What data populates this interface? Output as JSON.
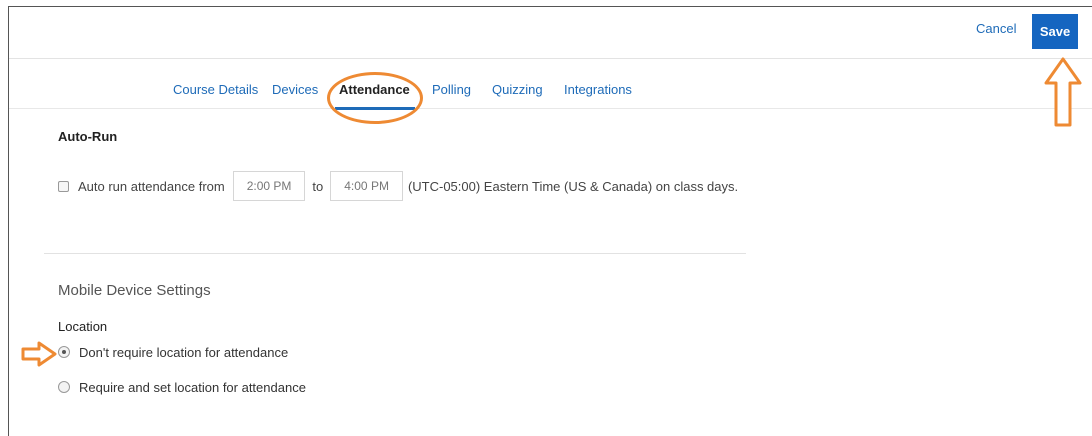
{
  "header": {
    "cancel_label": "Cancel",
    "save_label": "Save"
  },
  "tabs": [
    {
      "label": "Course Details",
      "active": false
    },
    {
      "label": "Devices",
      "active": false
    },
    {
      "label": "Attendance",
      "active": true
    },
    {
      "label": "Polling",
      "active": false
    },
    {
      "label": "Quizzing",
      "active": false
    },
    {
      "label": "Integrations",
      "active": false
    }
  ],
  "auto_run": {
    "section_title": "Auto-Run",
    "checkbox_checked": false,
    "label_prefix": "Auto run attendance from",
    "start_time": "2:00 PM",
    "to_label": "to",
    "end_time": "4:00 PM",
    "suffix": "(UTC-05:00) Eastern Time (US & Canada) on class days."
  },
  "mobile_settings": {
    "heading": "Mobile Device Settings",
    "location_label": "Location",
    "options": [
      {
        "label": "Don't require location for attendance",
        "selected": true
      },
      {
        "label": "Require and set location for attendance",
        "selected": false
      }
    ]
  },
  "colors": {
    "accent": "#1e6bb8",
    "primary_button": "#1565c0",
    "annotation": "#ee8a33"
  },
  "icons": {
    "save_annotation": "arrow-up-icon",
    "radio_annotation": "arrow-right-icon"
  }
}
